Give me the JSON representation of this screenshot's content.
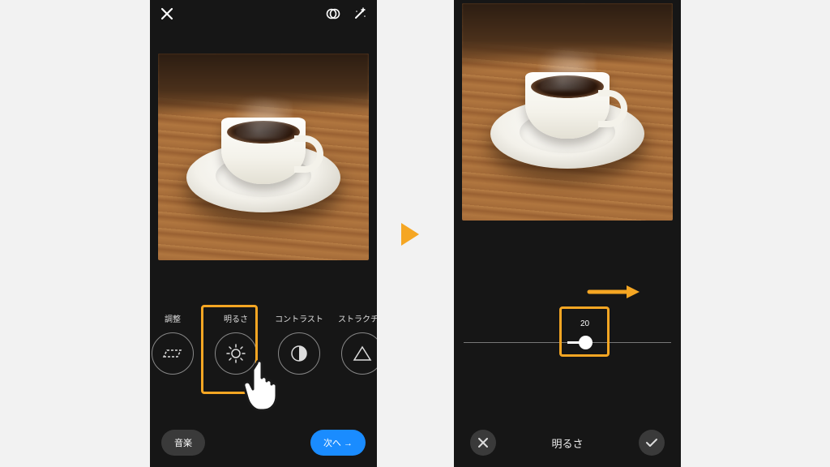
{
  "phone1": {
    "topbar": {
      "close": "close-icon",
      "overlap": "overlap-icon",
      "wand": "wand-icon"
    },
    "edit_items": [
      {
        "label": "調整",
        "icon": "adjust-crop-icon"
      },
      {
        "label": "明るさ",
        "icon": "brightness-sun-icon"
      },
      {
        "label": "コントラスト",
        "icon": "contrast-icon"
      },
      {
        "label": "ストラクチャ",
        "icon": "structure-triangle-icon"
      }
    ],
    "highlighted_index": 1,
    "bottom": {
      "music_label": "音楽",
      "next_label": "次へ →"
    }
  },
  "phone2": {
    "slider": {
      "value": "20"
    },
    "bottom": {
      "title": "明るさ"
    }
  },
  "colors": {
    "accent": "#f5a623",
    "primary_blue": "#1a8cff"
  }
}
